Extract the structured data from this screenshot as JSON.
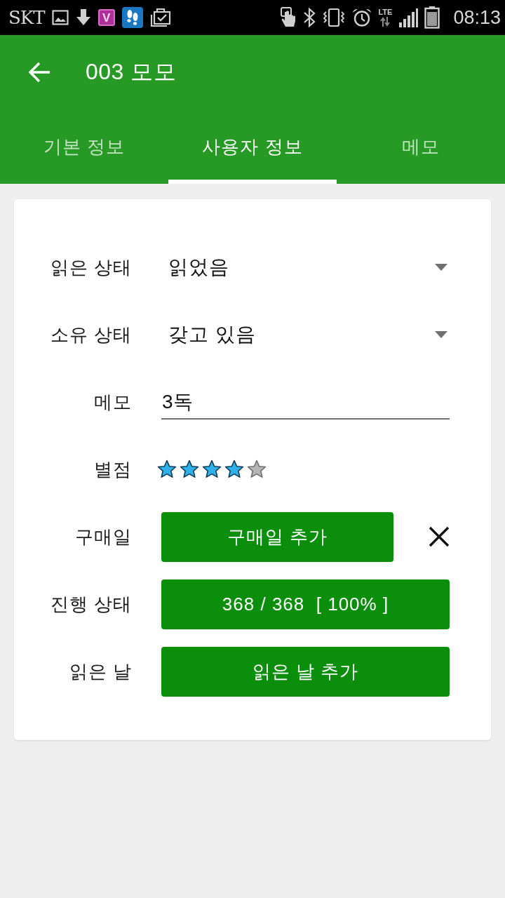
{
  "status_bar": {
    "carrier": "SKT",
    "app_badge": "V",
    "network": "LTE",
    "time": "08:13"
  },
  "app_bar": {
    "title": "003 모모"
  },
  "tabs": [
    {
      "label": "기본 정보",
      "selected": false
    },
    {
      "label": "사용자 정보",
      "selected": true
    },
    {
      "label": "메모",
      "selected": false
    }
  ],
  "form": {
    "rows": [
      {
        "kind": "dropdown",
        "label": "읽은 상태",
        "value": "읽었음"
      },
      {
        "kind": "dropdown",
        "label": "소유 상태",
        "value": "갖고 있음"
      },
      {
        "kind": "text",
        "label": "메모",
        "value": "3독"
      },
      {
        "kind": "rating",
        "label": "별점",
        "stars": 4
      },
      {
        "kind": "button",
        "label": "구매일",
        "button": "구매일 추가",
        "clearable": true
      },
      {
        "kind": "button",
        "label": "진행 상태",
        "button": "368 / 368  [ 100% ]",
        "clearable": false
      },
      {
        "kind": "button",
        "label": "읽은 날",
        "button": "읽은 날 추가",
        "clearable": false
      }
    ]
  }
}
